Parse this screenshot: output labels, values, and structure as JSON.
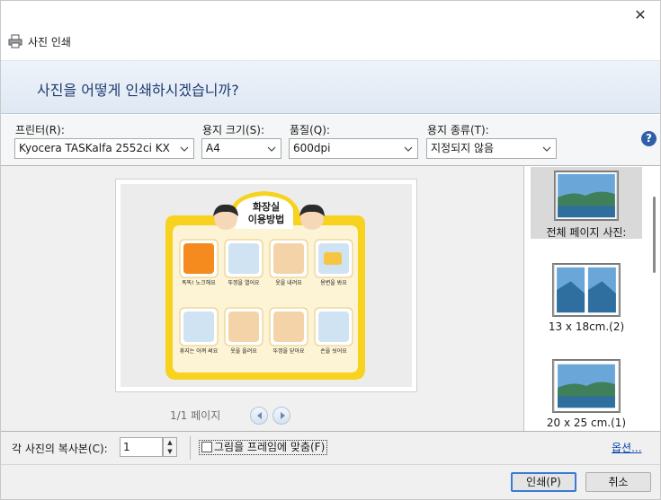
{
  "window": {
    "title": "사진 인쇄",
    "close": "✕",
    "heading": "사진을 어떻게 인쇄하시겠습니까?"
  },
  "options": {
    "printer": {
      "label": "프린터(R):",
      "value": "Kyocera TASKalfa 2552ci KX"
    },
    "paper_size": {
      "label": "용지 크기(S):",
      "value": "A4"
    },
    "quality": {
      "label": "품질(Q):",
      "value": "600dpi"
    },
    "paper_type": {
      "label": "용지 종류(T):",
      "value": "지정되지 않음"
    },
    "help": "?"
  },
  "poster": {
    "title_line1": "화장실",
    "title_line2": "이용방법",
    "steps": [
      "똑똑! 노크해요",
      "뚜껑을 열어요",
      "옷을 내려요",
      "용변을 봐요",
      "휴지는 아껴 써요",
      "옷을 올려요",
      "뚜껑을 닫아요",
      "손을 씻어요"
    ]
  },
  "preview": {
    "pager": "1/1 페이지"
  },
  "layouts": [
    {
      "label": "전체 페이지 사진:"
    },
    {
      "label": "13 x 18cm.(2)"
    },
    {
      "label": "20 x 25 cm.(1)"
    }
  ],
  "bottom": {
    "copies_label": "각 사진의 복사본(C):",
    "copies_value": "1",
    "fit_label": "그림을 프레임에 맞춤(F)",
    "options_link": "옵션...",
    "print_button": "인쇄(P)",
    "cancel_button": "취소"
  },
  "colors": {
    "accent": "#3a7bd5",
    "poster_yellow": "#f7d21e",
    "poster_cream": "#fdf3d5",
    "banner_text": "#1e3a6e"
  }
}
